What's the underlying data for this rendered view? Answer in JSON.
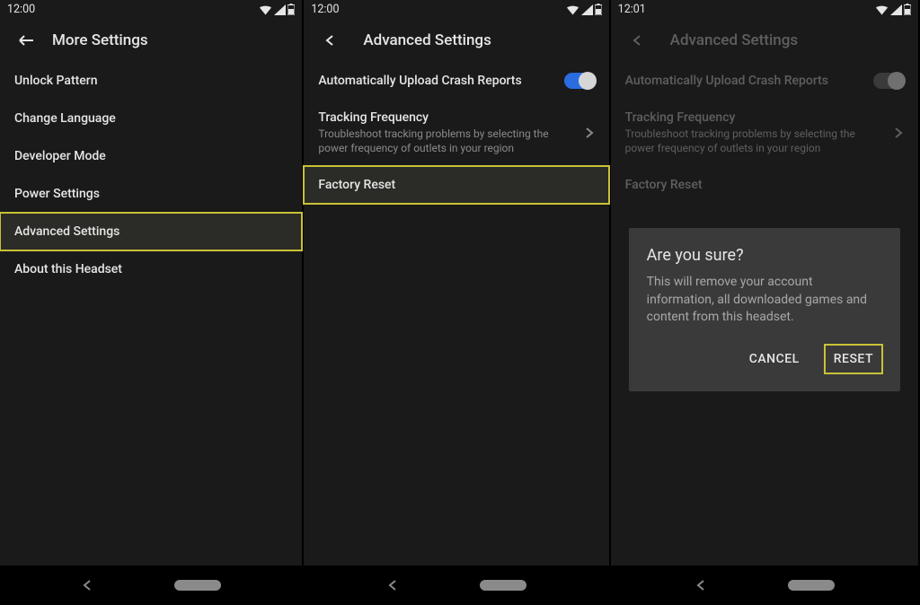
{
  "panel1": {
    "time": "12:00",
    "header": "More Settings",
    "items": [
      {
        "label": "Unlock Pattern"
      },
      {
        "label": "Change Language"
      },
      {
        "label": "Developer Mode"
      },
      {
        "label": "Power Settings"
      },
      {
        "label": "Advanced Settings",
        "highlighted": true
      },
      {
        "label": "About this Headset"
      }
    ]
  },
  "panel2": {
    "time": "12:00",
    "header": "Advanced Settings",
    "crash_label": "Automatically Upload Crash Reports",
    "tracking": {
      "title": "Tracking Frequency",
      "subtitle": "Troubleshoot tracking problems by selecting the power frequency of outlets in your region"
    },
    "factory_reset": "Factory Reset"
  },
  "panel3": {
    "time": "12:01",
    "header": "Advanced Settings",
    "crash_label": "Automatically Upload Crash Reports",
    "tracking": {
      "title": "Tracking Frequency",
      "subtitle": "Troubleshoot tracking problems by selecting the power frequency of outlets in your region"
    },
    "factory_reset": "Factory Reset",
    "dialog": {
      "title": "Are you sure?",
      "body": "This will remove your account information, all downloaded games and content from this headset.",
      "cancel": "CANCEL",
      "reset": "RESET"
    }
  }
}
